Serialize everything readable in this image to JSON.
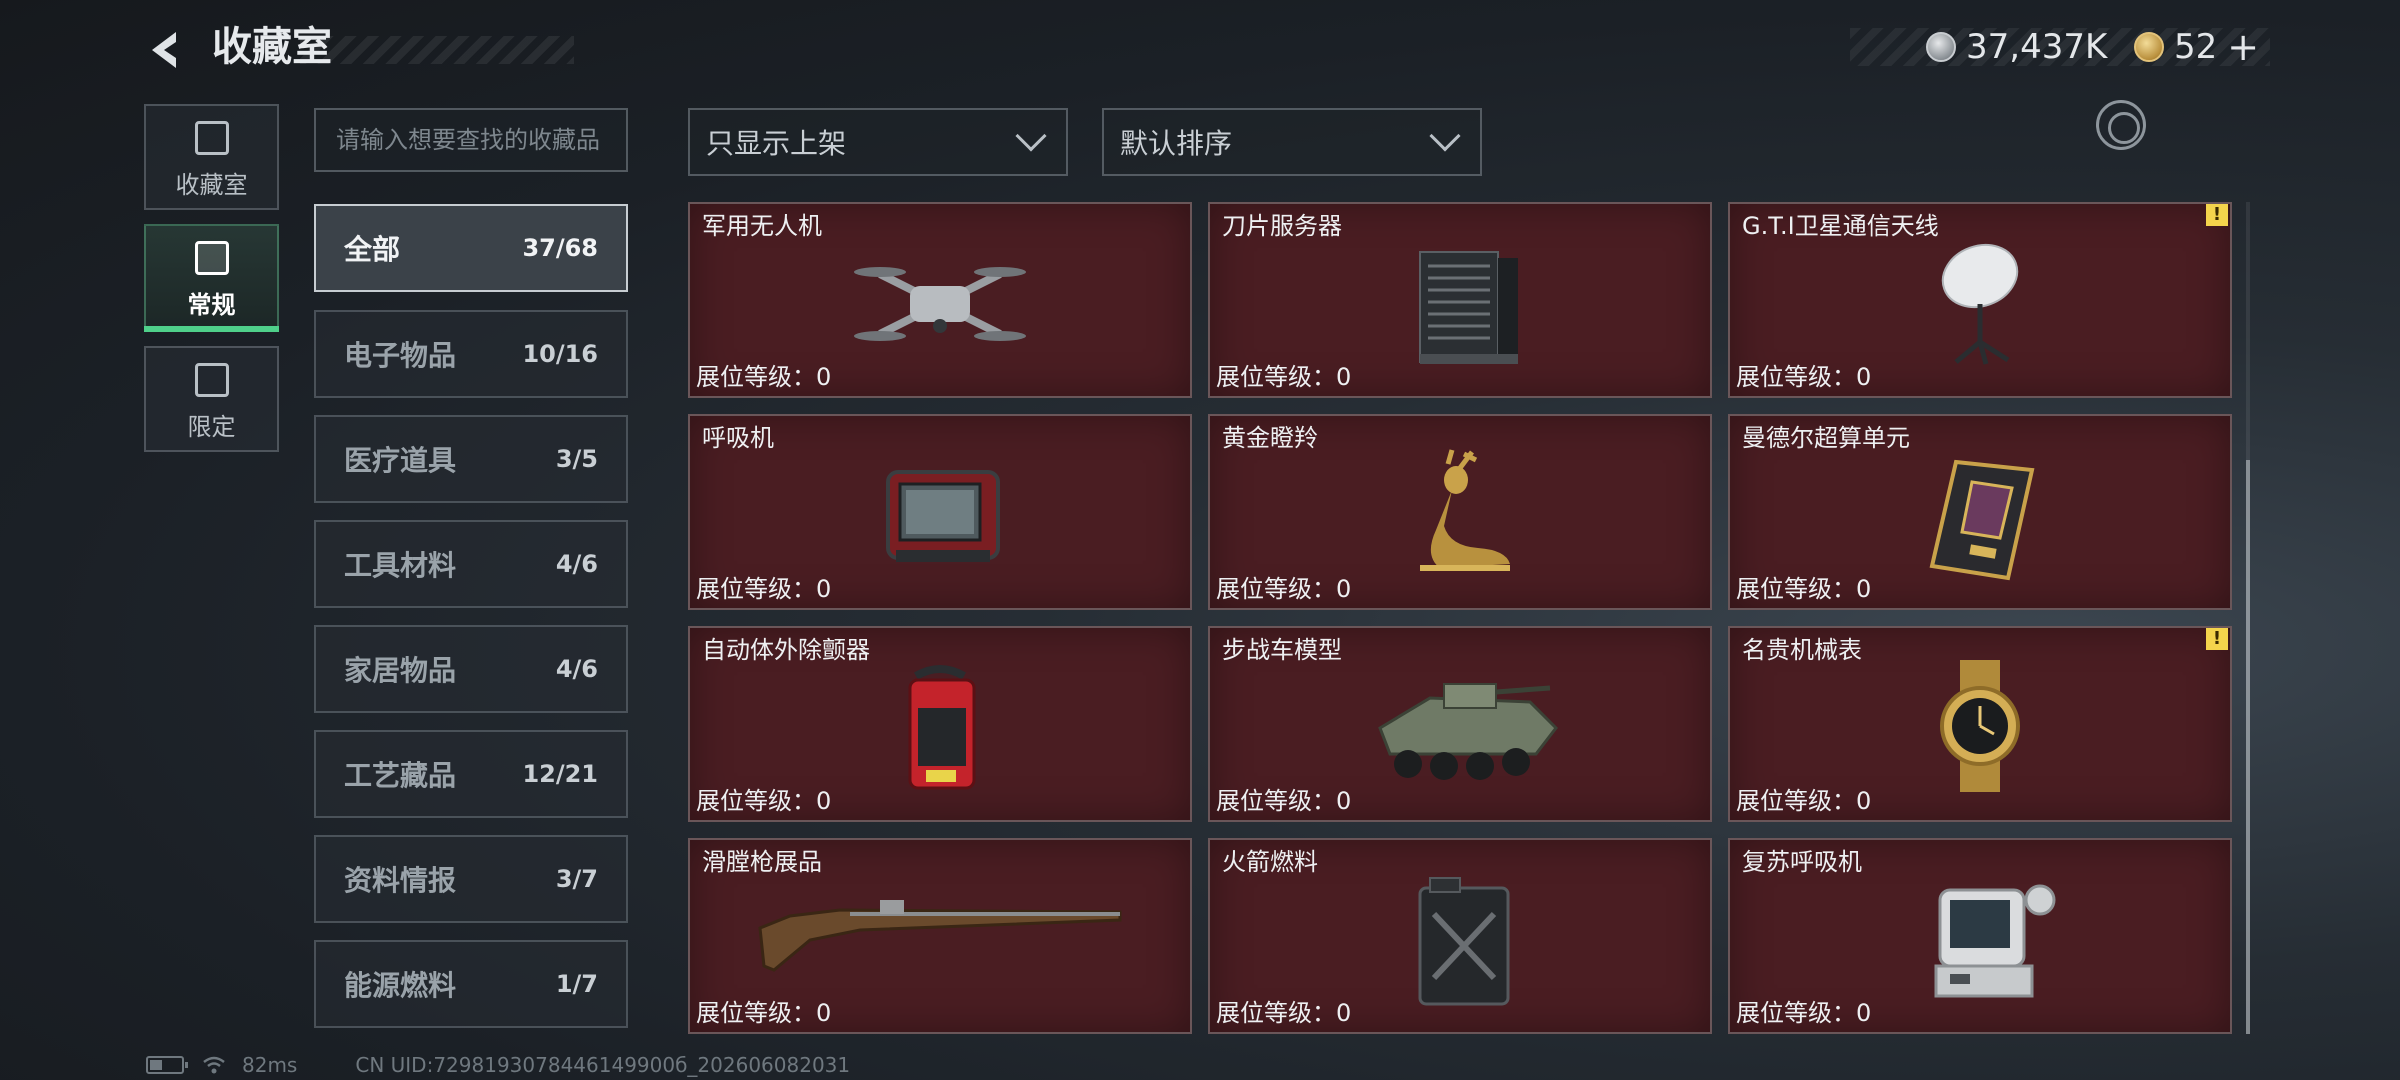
{
  "header": {
    "title": "收藏室",
    "back_icon": "chevron-left-icon"
  },
  "currency": {
    "silver_amount": "37,437K",
    "gold_amount": "52",
    "gold_plus": "+"
  },
  "left_tabs": [
    {
      "label": "收藏室",
      "icon": "collection-room-icon",
      "active": false
    },
    {
      "label": "常规",
      "icon": "regular-icon",
      "active": true
    },
    {
      "label": "限定",
      "icon": "limited-icon",
      "active": false
    }
  ],
  "search": {
    "placeholder": "请输入想要查找的收藏品",
    "value": ""
  },
  "categories": [
    {
      "label": "全部",
      "count": "37/68",
      "active": true
    },
    {
      "label": "电子物品",
      "count": "10/16",
      "active": false
    },
    {
      "label": "医疗道具",
      "count": "3/5",
      "active": false
    },
    {
      "label": "工具材料",
      "count": "4/6",
      "active": false
    },
    {
      "label": "家居物品",
      "count": "4/6",
      "active": false
    },
    {
      "label": "工艺藏品",
      "count": "12/21",
      "active": false
    },
    {
      "label": "资料情报",
      "count": "3/7",
      "active": false
    },
    {
      "label": "能源燃料",
      "count": "1/7",
      "active": false
    }
  ],
  "filters": {
    "display_filter": "只显示上架",
    "sort_order": "默认排序"
  },
  "items": [
    {
      "name": "军用无人机",
      "level": "展位等级：0",
      "icon": "drone-icon",
      "alert": false
    },
    {
      "name": "刀片服务器",
      "level": "展位等级：0",
      "icon": "server-icon",
      "alert": false
    },
    {
      "name": "G.T.I卫星通信天线",
      "level": "展位等级：0",
      "icon": "satellite-dish-icon",
      "alert": true
    },
    {
      "name": "呼吸机",
      "level": "展位等级：0",
      "icon": "ventilator-icon",
      "alert": false
    },
    {
      "name": "黄金瞪羚",
      "level": "展位等级：0",
      "icon": "gold-gazelle-icon",
      "alert": false
    },
    {
      "name": "曼德尔超算单元",
      "level": "展位等级：0",
      "icon": "supercomputer-unit-icon",
      "alert": false
    },
    {
      "name": "自动体外除颤器",
      "level": "展位等级：0",
      "icon": "defibrillator-icon",
      "alert": false
    },
    {
      "name": "步战车模型",
      "level": "展位等级：0",
      "icon": "ifv-model-icon",
      "alert": false
    },
    {
      "name": "名贵机械表",
      "level": "展位等级：0",
      "icon": "luxury-watch-icon",
      "alert": true
    },
    {
      "name": "滑膛枪展品",
      "level": "展位等级：0",
      "icon": "musket-icon",
      "alert": false
    },
    {
      "name": "火箭燃料",
      "level": "展位等级：0",
      "icon": "fuel-canister-icon",
      "alert": false
    },
    {
      "name": "复苏呼吸机",
      "level": "展位等级：0",
      "icon": "resuscitator-icon",
      "alert": false
    }
  ],
  "alert_symbol": "!",
  "footer": {
    "ping": "82ms",
    "uid": "CN UID:7298193078446149900б_202606082031"
  },
  "colors": {
    "card_bg": "#4a1d22",
    "active_tab_accent": "#4fd08a",
    "alert_badge": "#f4d44c"
  }
}
